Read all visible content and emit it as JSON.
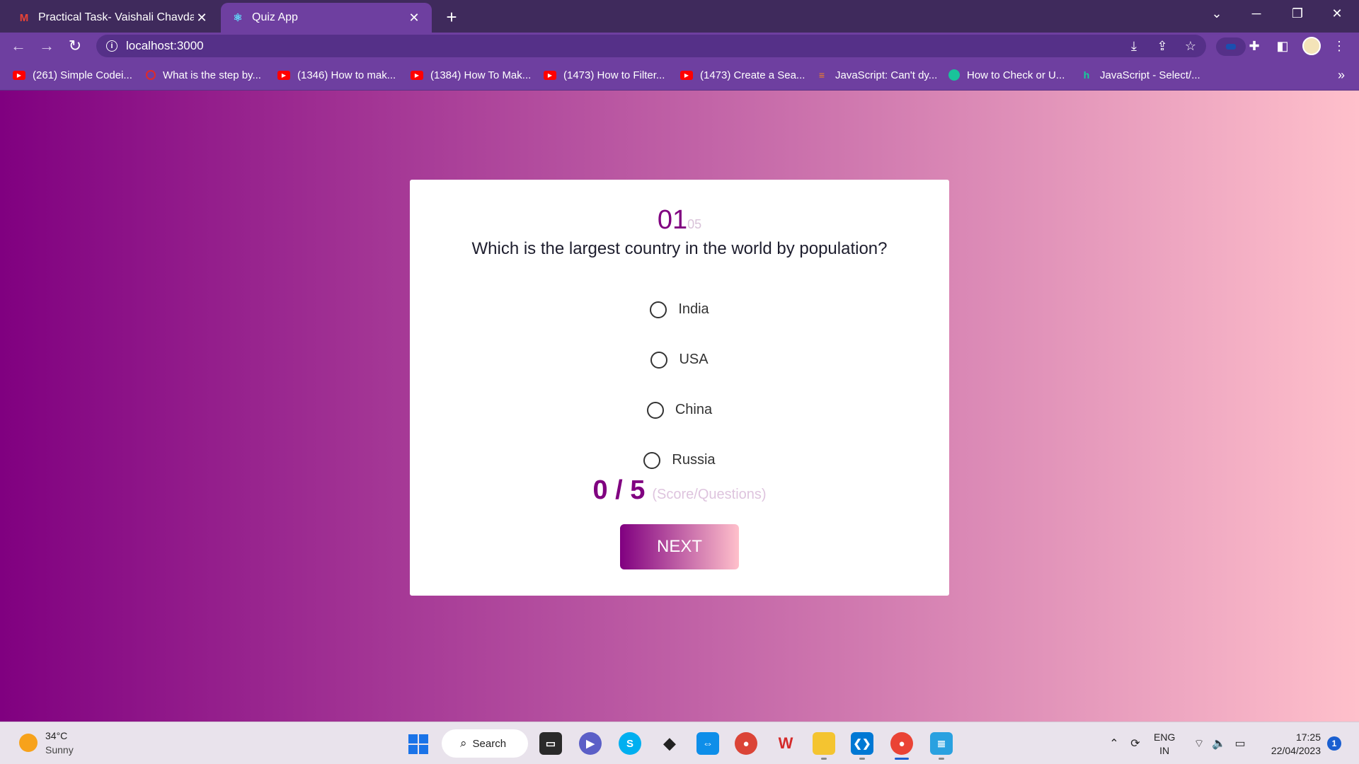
{
  "browser": {
    "tabs": [
      {
        "title": "Practical Task- Vaishali Chavda -",
        "favicon": "gmail-icon",
        "active": false
      },
      {
        "title": "Quiz App",
        "favicon": "react-icon",
        "active": true
      }
    ],
    "address": "localhost:3000",
    "bookmarks": [
      {
        "label": "(261) Simple Codei...",
        "icon": "youtube-icon"
      },
      {
        "label": "What is the step by...",
        "icon": "quora-icon"
      },
      {
        "label": "(1346) How to mak...",
        "icon": "youtube-icon"
      },
      {
        "label": "(1384) How To Mak...",
        "icon": "youtube-icon"
      },
      {
        "label": "(1473) How to Filter...",
        "icon": "youtube-icon"
      },
      {
        "label": "(1473) Create a Sea...",
        "icon": "youtube-icon"
      },
      {
        "label": "JavaScript: Can't dy...",
        "icon": "stackoverflow-icon"
      },
      {
        "label": "How to Check or U...",
        "icon": "gem-icon"
      },
      {
        "label": "JavaScript - Select/...",
        "icon": "hashnode-icon"
      }
    ]
  },
  "quiz": {
    "question_number": "01",
    "total_questions": "05",
    "question": "Which is the largest country in the world by population?",
    "options": [
      "India",
      "USA",
      "China",
      "Russia"
    ],
    "score": "0 / 5",
    "score_label": "(Score/Questions)",
    "next_label": "NEXT"
  },
  "taskbar": {
    "weather_temp": "34°C",
    "weather_condition": "Sunny",
    "search_label": "Search",
    "language": "ENG",
    "region": "IN",
    "time": "17:25",
    "date": "22/04/2023",
    "notification_count": "1"
  },
  "colors": {
    "gradient_start": "#800080",
    "gradient_end": "#ffc0cb",
    "tab_bar": "#3f2a5c",
    "toolbar": "#6e3fa0"
  }
}
